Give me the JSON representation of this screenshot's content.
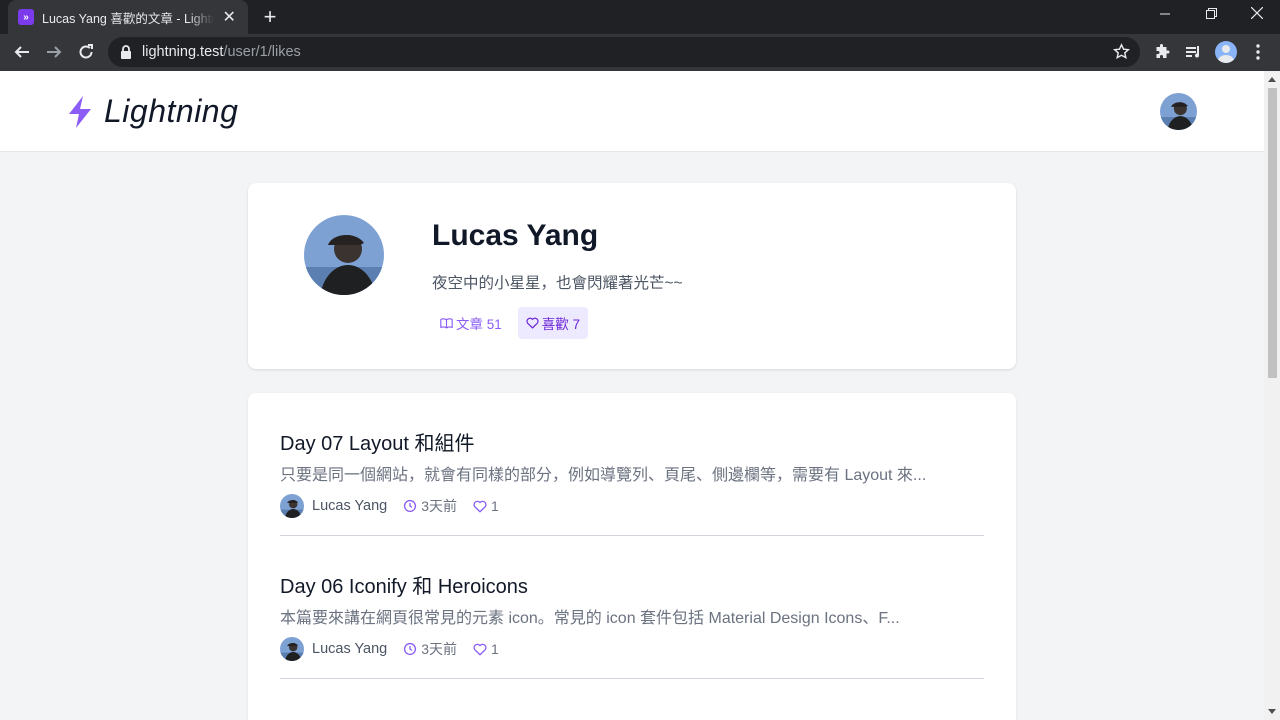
{
  "browser": {
    "tab_title": "Lucas Yang 喜歡的文章 - Lightning",
    "tab_favicon_glyph": "»",
    "url_host": "lightning.test",
    "url_path": "/user/1/likes",
    "accent": "#7c3aed"
  },
  "header": {
    "brand": "Lightning"
  },
  "profile": {
    "name": "Lucas Yang",
    "bio": "夜空中的小星星，也會閃耀著光芒~~",
    "stats": {
      "posts_label": "文章 51",
      "likes_label": "喜歡 7"
    }
  },
  "posts": [
    {
      "title": "Day 07 Layout 和組件",
      "excerpt": "只要是同一個網站，就會有同樣的部分，例如導覽列、頁尾、側邊欄等，需要有 Layout 來...",
      "author": "Lucas Yang",
      "time": "3天前",
      "likes": "1"
    },
    {
      "title": "Day 06 Iconify 和 Heroicons",
      "excerpt": "本篇要來講在網頁很常見的元素 icon。常見的 icon 套件包括 Material Design Icons、F...",
      "author": "Lucas Yang",
      "time": "3天前",
      "likes": "1"
    }
  ]
}
